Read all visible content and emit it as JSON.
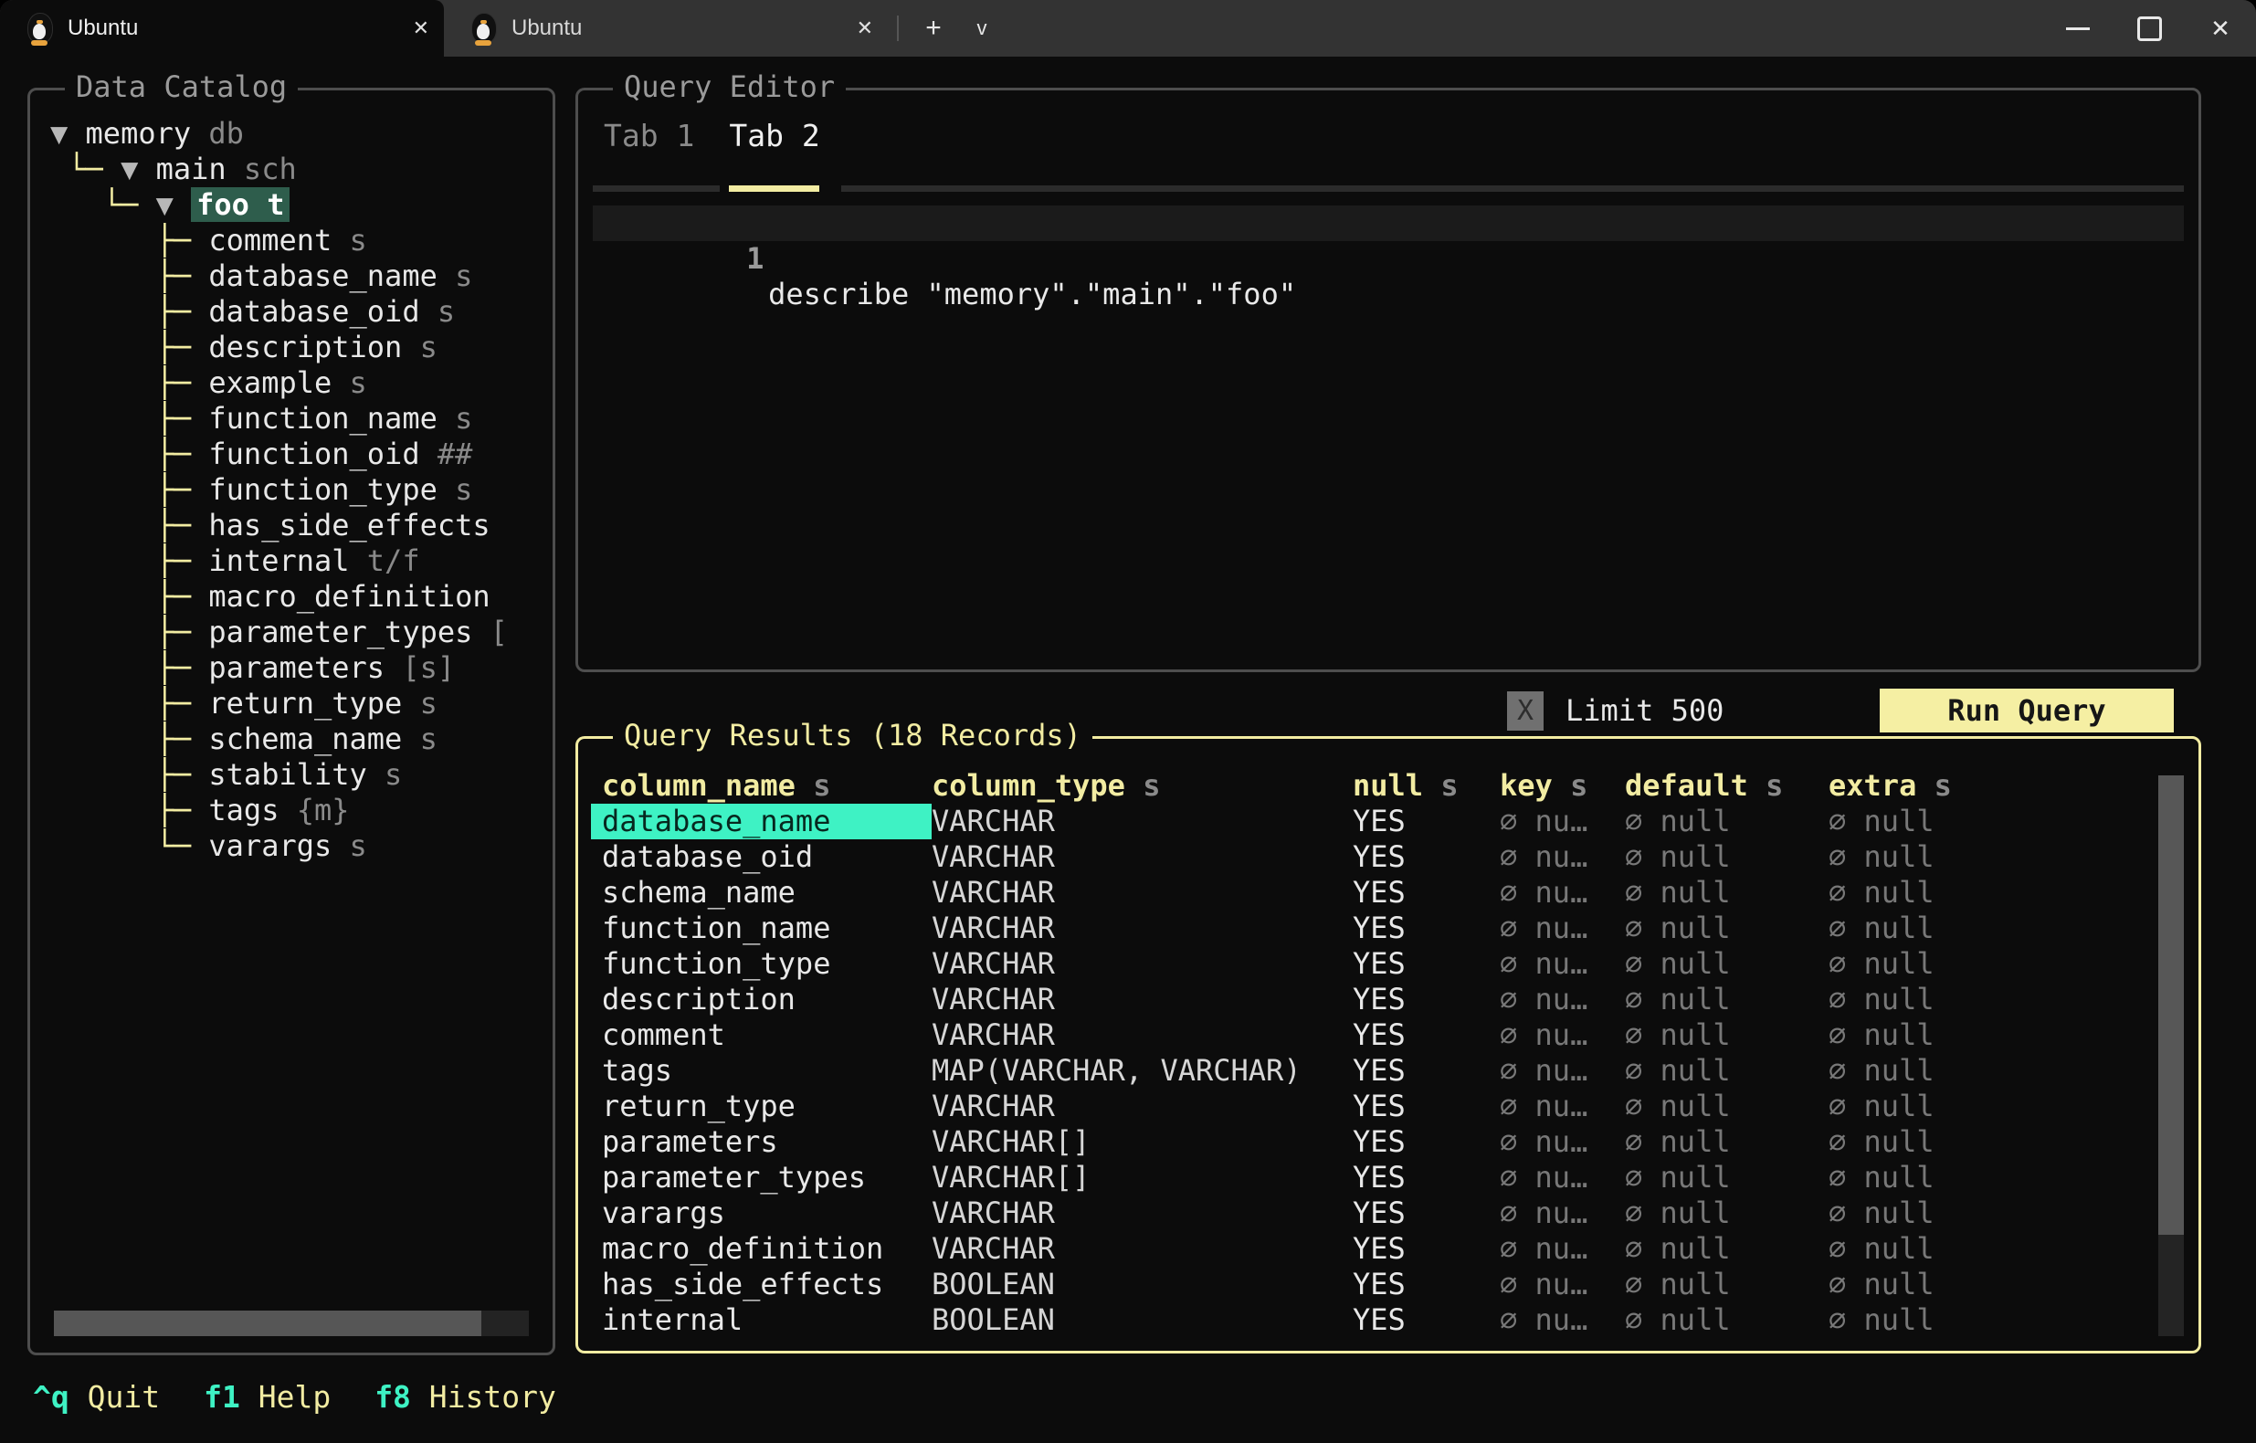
{
  "titlebar": {
    "tabs": [
      {
        "label": "Ubuntu",
        "active": true
      },
      {
        "label": "Ubuntu",
        "active": false
      }
    ],
    "tab_close_glyph": "✕",
    "new_tab_glyph": "+",
    "dropdown_glyph": "v",
    "close_glyph": "✕"
  },
  "catalog": {
    "title": "Data Catalog",
    "tree": [
      {
        "prefix": "",
        "arrow": "▼",
        "label": "memory",
        "suffix": "db",
        "selected": false
      },
      {
        "prefix": " └─ ",
        "arrow": "▼",
        "label": "main",
        "suffix": "sch",
        "selected": false
      },
      {
        "prefix": "   └─ ",
        "arrow": "▼",
        "label": "foo",
        "suffix": "t",
        "selected": true
      },
      {
        "prefix": "      ├─ ",
        "arrow": "",
        "label": "comment",
        "suffix": "s",
        "selected": false
      },
      {
        "prefix": "      ├─ ",
        "arrow": "",
        "label": "database_name",
        "suffix": "s",
        "selected": false
      },
      {
        "prefix": "      ├─ ",
        "arrow": "",
        "label": "database_oid",
        "suffix": "s",
        "selected": false
      },
      {
        "prefix": "      ├─ ",
        "arrow": "",
        "label": "description",
        "suffix": "s",
        "selected": false
      },
      {
        "prefix": "      ├─ ",
        "arrow": "",
        "label": "example",
        "suffix": "s",
        "selected": false
      },
      {
        "prefix": "      ├─ ",
        "arrow": "",
        "label": "function_name",
        "suffix": "s",
        "selected": false
      },
      {
        "prefix": "      ├─ ",
        "arrow": "",
        "label": "function_oid",
        "suffix": "##",
        "selected": false
      },
      {
        "prefix": "      ├─ ",
        "arrow": "",
        "label": "function_type",
        "suffix": "s",
        "selected": false
      },
      {
        "prefix": "      ├─ ",
        "arrow": "",
        "label": "has_side_effects",
        "suffix": "",
        "selected": false
      },
      {
        "prefix": "      ├─ ",
        "arrow": "",
        "label": "internal",
        "suffix": "t/f",
        "selected": false
      },
      {
        "prefix": "      ├─ ",
        "arrow": "",
        "label": "macro_definition",
        "suffix": "",
        "selected": false
      },
      {
        "prefix": "      ├─ ",
        "arrow": "",
        "label": "parameter_types",
        "suffix": "[",
        "selected": false
      },
      {
        "prefix": "      ├─ ",
        "arrow": "",
        "label": "parameters",
        "suffix": "[s]",
        "selected": false
      },
      {
        "prefix": "      ├─ ",
        "arrow": "",
        "label": "return_type",
        "suffix": "s",
        "selected": false
      },
      {
        "prefix": "      ├─ ",
        "arrow": "",
        "label": "schema_name",
        "suffix": "s",
        "selected": false
      },
      {
        "prefix": "      ├─ ",
        "arrow": "",
        "label": "stability",
        "suffix": "s",
        "selected": false
      },
      {
        "prefix": "      ├─ ",
        "arrow": "",
        "label": "tags",
        "suffix": "{m}",
        "selected": false
      },
      {
        "prefix": "      └─ ",
        "arrow": "",
        "label": "varargs",
        "suffix": "s",
        "selected": false
      }
    ]
  },
  "editor": {
    "title": "Query Editor",
    "tabs": [
      {
        "label": "Tab 1",
        "active": false
      },
      {
        "label": "Tab 2",
        "active": true
      }
    ],
    "line_number": "1",
    "code": "describe \"memory\".\"main\".\"foo\""
  },
  "controls": {
    "limit_checkbox_glyph": "X",
    "limit_label": "Limit 500",
    "run_button_label": "Run Query"
  },
  "results": {
    "title": "Query Results (18 Records)",
    "columns": [
      {
        "label": "column_name",
        "suffix": "s"
      },
      {
        "label": "column_type",
        "suffix": "s"
      },
      {
        "label": "null",
        "suffix": "s"
      },
      {
        "label": "key",
        "suffix": "s"
      },
      {
        "label": "default",
        "suffix": "s"
      },
      {
        "label": "extra",
        "suffix": "s"
      }
    ],
    "rows": [
      [
        "database_name",
        "VARCHAR",
        "YES",
        "∅ nu…",
        "∅ null",
        "∅ null"
      ],
      [
        "database_oid",
        "VARCHAR",
        "YES",
        "∅ nu…",
        "∅ null",
        "∅ null"
      ],
      [
        "schema_name",
        "VARCHAR",
        "YES",
        "∅ nu…",
        "∅ null",
        "∅ null"
      ],
      [
        "function_name",
        "VARCHAR",
        "YES",
        "∅ nu…",
        "∅ null",
        "∅ null"
      ],
      [
        "function_type",
        "VARCHAR",
        "YES",
        "∅ nu…",
        "∅ null",
        "∅ null"
      ],
      [
        "description",
        "VARCHAR",
        "YES",
        "∅ nu…",
        "∅ null",
        "∅ null"
      ],
      [
        "comment",
        "VARCHAR",
        "YES",
        "∅ nu…",
        "∅ null",
        "∅ null"
      ],
      [
        "tags",
        "MAP(VARCHAR, VARCHAR)",
        "YES",
        "∅ nu…",
        "∅ null",
        "∅ null"
      ],
      [
        "return_type",
        "VARCHAR",
        "YES",
        "∅ nu…",
        "∅ null",
        "∅ null"
      ],
      [
        "parameters",
        "VARCHAR[]",
        "YES",
        "∅ nu…",
        "∅ null",
        "∅ null"
      ],
      [
        "parameter_types",
        "VARCHAR[]",
        "YES",
        "∅ nu…",
        "∅ null",
        "∅ null"
      ],
      [
        "varargs",
        "VARCHAR",
        "YES",
        "∅ nu…",
        "∅ null",
        "∅ null"
      ],
      [
        "macro_definition",
        "VARCHAR",
        "YES",
        "∅ nu…",
        "∅ null",
        "∅ null"
      ],
      [
        "has_side_effects",
        "BOOLEAN",
        "YES",
        "∅ nu…",
        "∅ null",
        "∅ null"
      ],
      [
        "internal",
        "BOOLEAN",
        "YES",
        "∅ nu…",
        "∅ null",
        "∅ null"
      ]
    ],
    "selected_cell": {
      "row": 0,
      "column": 0
    }
  },
  "footer": {
    "shortcuts": [
      {
        "key": "^q",
        "label": "Quit"
      },
      {
        "key": "f1",
        "label": "Help"
      },
      {
        "key": "f8",
        "label": "History"
      }
    ]
  },
  "colors": {
    "terminal_bg": "#0c0c0c",
    "titlebar_bg": "#333333",
    "panel_border_gray": "#4e4e4e",
    "accent_yellow": "#f2eca2",
    "accent_cyan": "#3ef2c4",
    "tree_selection_bg": "#2e5d4c",
    "selected_cell_bg": "#3ef2c4",
    "run_button_bg": "#f5efa3"
  }
}
